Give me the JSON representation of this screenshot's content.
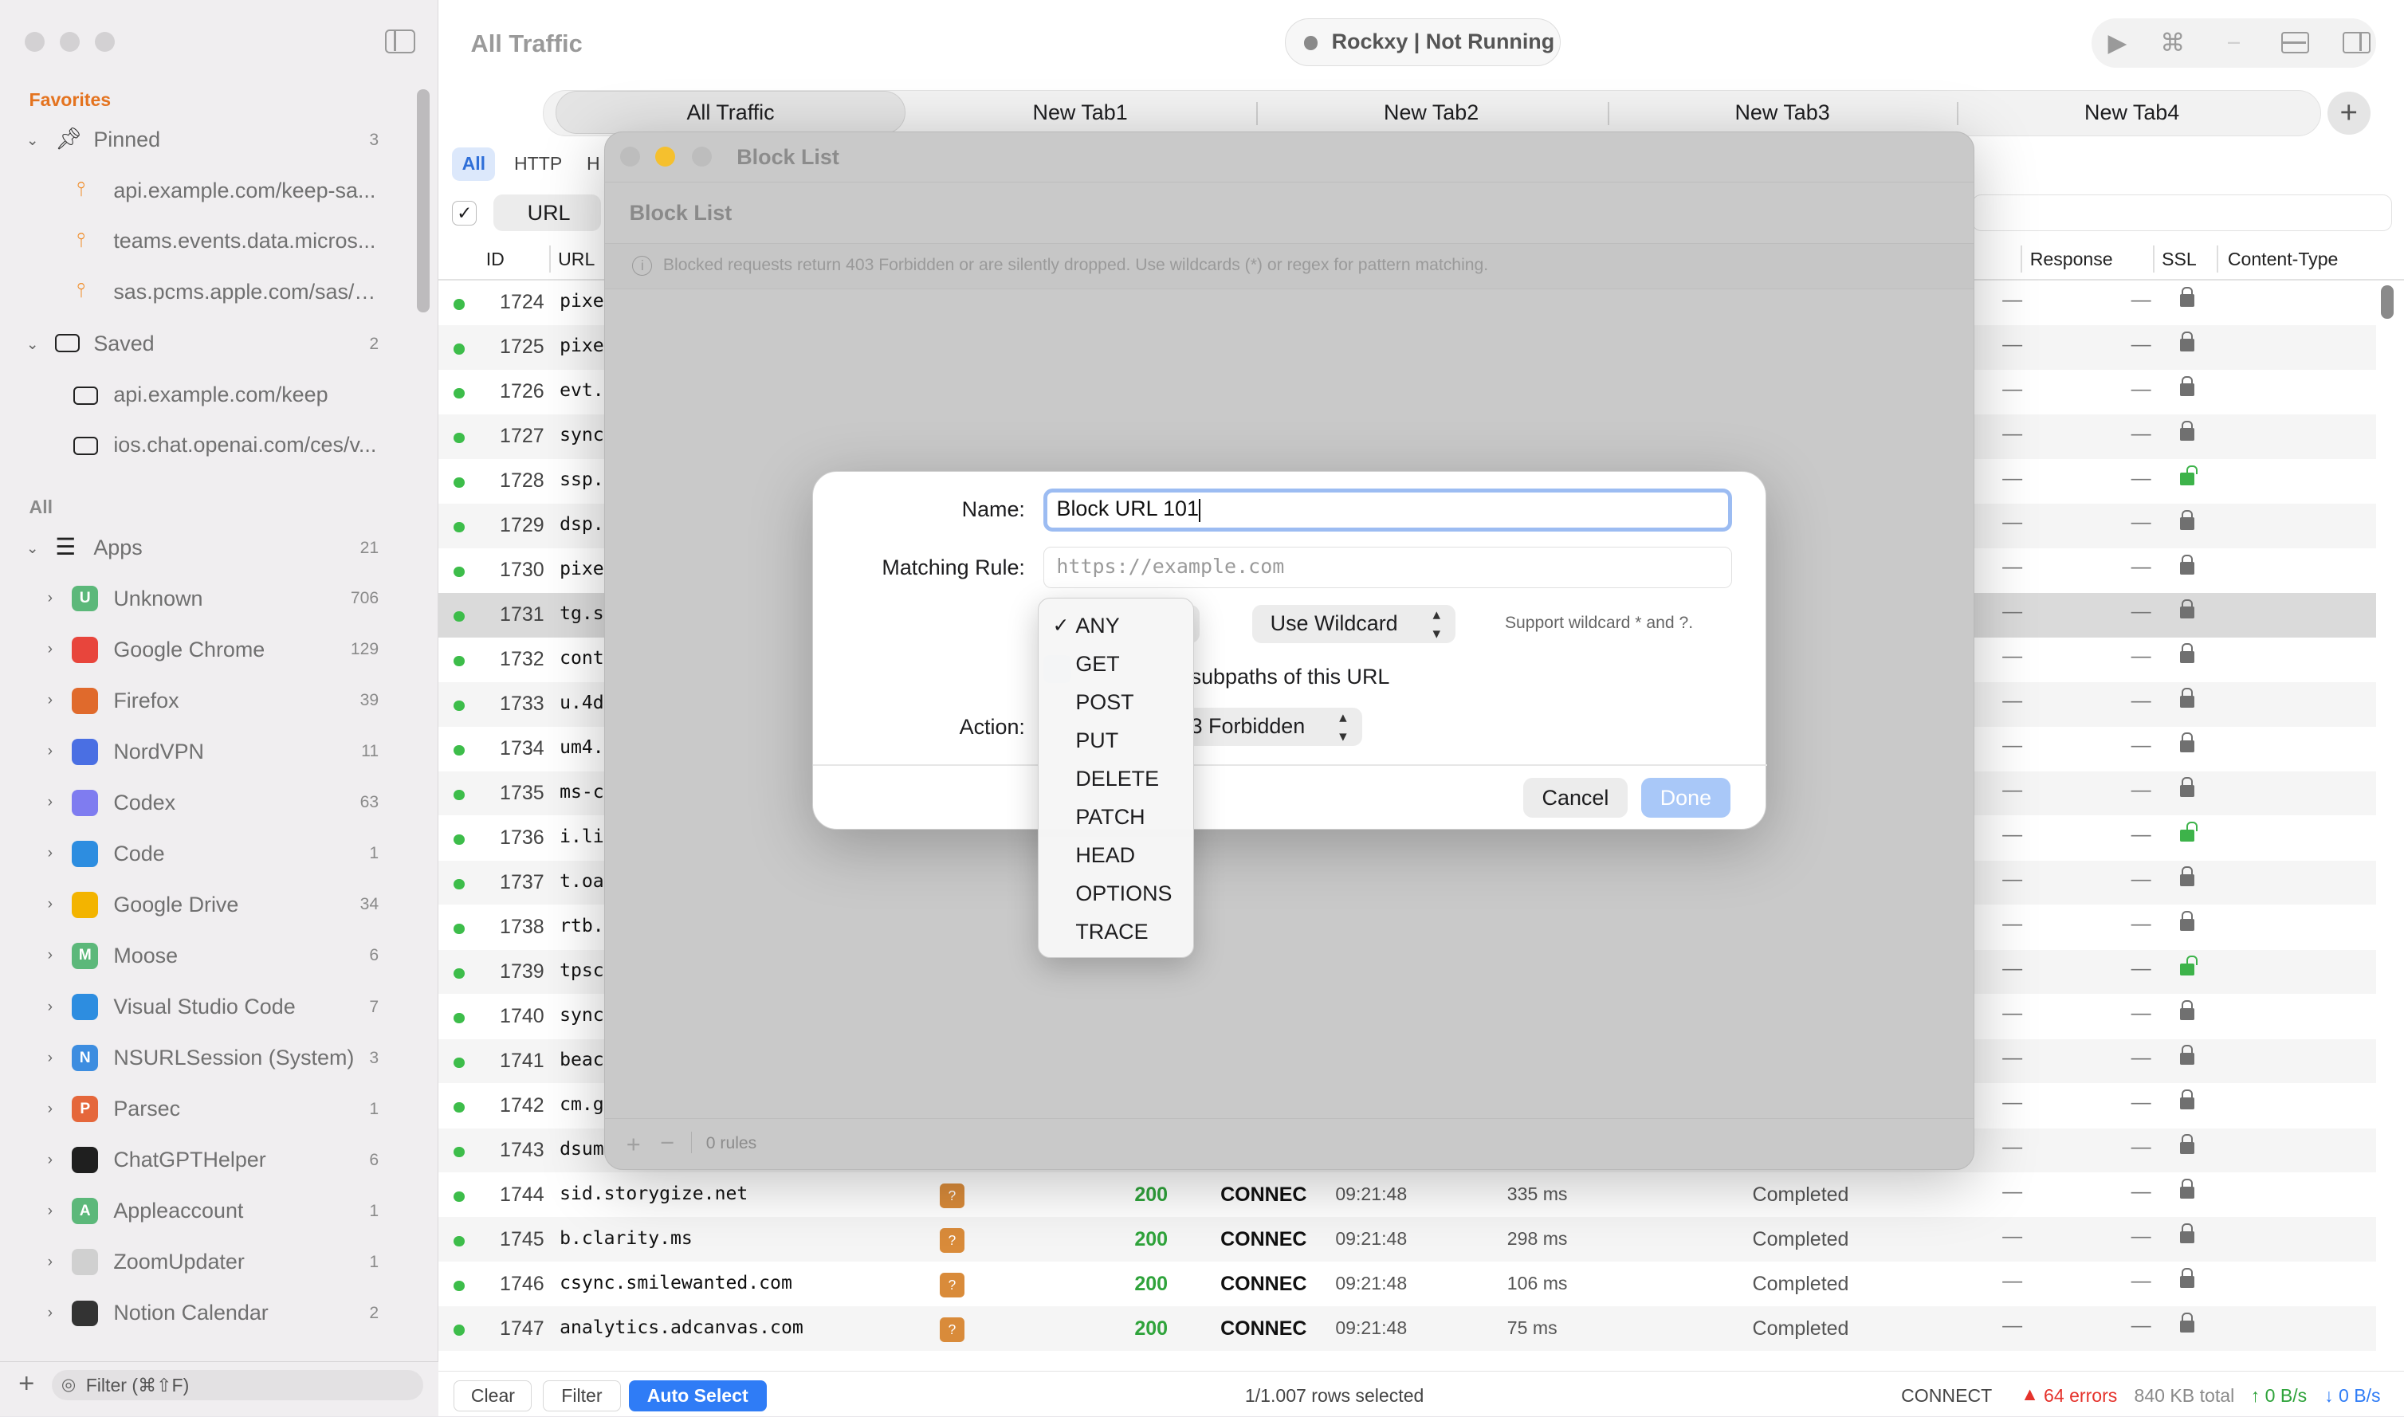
{
  "sidebar": {
    "favorites_header": "Favorites",
    "all_header": "All",
    "pinned": {
      "label": "Pinned",
      "count": "3"
    },
    "pinned_items": [
      "api.example.com/keep-sa...",
      "teams.events.data.micros...",
      "sas.pcms.apple.com/sas/v..."
    ],
    "saved": {
      "label": "Saved",
      "count": "2"
    },
    "saved_items": [
      "api.example.com/keep",
      "ios.chat.openai.com/ces/v..."
    ],
    "apps": {
      "label": "Apps",
      "count": "21"
    },
    "app_items": [
      {
        "label": "Unknown",
        "count": "706",
        "icon": "U",
        "color": "#5cb87a"
      },
      {
        "label": "Google Chrome",
        "count": "129",
        "icon": "",
        "color": "#e8453c"
      },
      {
        "label": "Firefox",
        "count": "39",
        "icon": "",
        "color": "#e06a2c"
      },
      {
        "label": "NordVPN",
        "count": "11",
        "icon": "",
        "color": "#4a6fe3"
      },
      {
        "label": "Codex",
        "count": "63",
        "icon": "",
        "color": "#7f7cf0"
      },
      {
        "label": "Code",
        "count": "1",
        "icon": "",
        "color": "#2d8de0"
      },
      {
        "label": "Google Drive",
        "count": "34",
        "icon": "",
        "color": "#f3b400"
      },
      {
        "label": "Moose",
        "count": "6",
        "icon": "M",
        "color": "#5cb87a"
      },
      {
        "label": "Visual Studio Code",
        "count": "7",
        "icon": "",
        "color": "#2d8de0"
      },
      {
        "label": "NSURLSession (System)",
        "count": "3",
        "icon": "N",
        "color": "#3d8de0"
      },
      {
        "label": "Parsec",
        "count": "1",
        "icon": "P",
        "color": "#e5673b"
      },
      {
        "label": "ChatGPTHelper",
        "count": "6",
        "icon": "",
        "color": "#1f1f1f"
      },
      {
        "label": "Appleaccount",
        "count": "1",
        "icon": "A",
        "color": "#5cb87a"
      },
      {
        "label": "ZoomUpdater",
        "count": "1",
        "icon": "",
        "color": "#d0d0d0"
      },
      {
        "label": "Notion Calendar",
        "count": "2",
        "icon": "",
        "color": "#333333"
      }
    ],
    "filter_placeholder": "Filter (⌘⇧F)"
  },
  "header": {
    "title": "All Traffic",
    "status": "Rockxy | Not Running"
  },
  "tabs": [
    "All Traffic",
    "New Tab1",
    "New Tab2",
    "New Tab3",
    "New Tab4"
  ],
  "chips": [
    "All",
    "HTTP",
    "H"
  ],
  "columns": {
    "id": "ID",
    "url": "URL",
    "url_filter": "URL",
    "response": "Response",
    "ssl": "SSL",
    "content_type": "Content-Type"
  },
  "rows": [
    {
      "id": "1724",
      "url": "pixe"
    },
    {
      "id": "1725",
      "url": "pixe"
    },
    {
      "id": "1726",
      "url": "evt."
    },
    {
      "id": "1727",
      "url": "sync"
    },
    {
      "id": "1728",
      "url": "ssp."
    },
    {
      "id": "1729",
      "url": "dsp."
    },
    {
      "id": "1730",
      "url": "pixe"
    },
    {
      "id": "1731",
      "url": "tg.s"
    },
    {
      "id": "1732",
      "url": "cont"
    },
    {
      "id": "1733",
      "url": "u.4d"
    },
    {
      "id": "1734",
      "url": "um4."
    },
    {
      "id": "1735",
      "url": "ms-c"
    },
    {
      "id": "1736",
      "url": "i.li"
    },
    {
      "id": "1737",
      "url": "t.oa"
    },
    {
      "id": "1738",
      "url": "rtb."
    },
    {
      "id": "1739",
      "url": "tpsc"
    },
    {
      "id": "1740",
      "url": "sync"
    },
    {
      "id": "1741",
      "url": "beac"
    },
    {
      "id": "1742",
      "url": "cm.g"
    },
    {
      "id": "1743",
      "url": "dsum"
    },
    {
      "id": "1744",
      "url": "sid.storygize.net",
      "code": "200",
      "method": "CONNEC",
      "time": "09:21:48",
      "duration": "335 ms",
      "status": "Completed"
    },
    {
      "id": "1745",
      "url": "b.clarity.ms",
      "code": "200",
      "method": "CONNEC",
      "time": "09:21:48",
      "duration": "298 ms",
      "status": "Completed"
    },
    {
      "id": "1746",
      "url": "csync.smilewanted.com",
      "code": "200",
      "method": "CONNEC",
      "time": "09:21:48",
      "duration": "106 ms",
      "status": "Completed"
    },
    {
      "id": "1747",
      "url": "analytics.adcanvas.com",
      "code": "200",
      "method": "CONNEC",
      "time": "09:21:48",
      "duration": "75 ms",
      "status": "Completed"
    }
  ],
  "dash": "—",
  "badge_glyph": "?",
  "bottom_bar": {
    "clear": "Clear",
    "filter": "Filter",
    "auto_select": "Auto Select",
    "selection": "1/1.007 rows selected",
    "method": "CONNECT",
    "errors": "64 errors",
    "total": "840 KB total",
    "up": "↑ 0 B/s",
    "down": "↓ 0 B/s"
  },
  "block_list": {
    "window_title": "Block List",
    "header": "Block List",
    "info": "Blocked requests return 403 Forbidden or are silently dropped. Use wildcards (*) or regex for pattern matching.",
    "rules_count": "0 rules"
  },
  "dialog": {
    "name_label": "Name:",
    "name_value": "Block URL 101",
    "rule_label": "Matching Rule:",
    "rule_placeholder": "https://example.com",
    "match_mode": "Use Wildcard",
    "support_hint": "Support wildcard * and ?.",
    "subpaths_text": "subpaths of this URL",
    "action_label": "Action:",
    "action_value": "3 Forbidden",
    "cancel": "Cancel",
    "done": "Done"
  },
  "method_menu": {
    "items": [
      "ANY",
      "GET",
      "POST",
      "PUT",
      "DELETE",
      "PATCH",
      "HEAD",
      "OPTIONS",
      "TRACE"
    ],
    "selected": "ANY",
    "check": "✓"
  },
  "colors": {
    "accent": "#2f7cf6",
    "success": "#2fa33b",
    "error": "#e5322b",
    "pin": "#f08a24"
  }
}
